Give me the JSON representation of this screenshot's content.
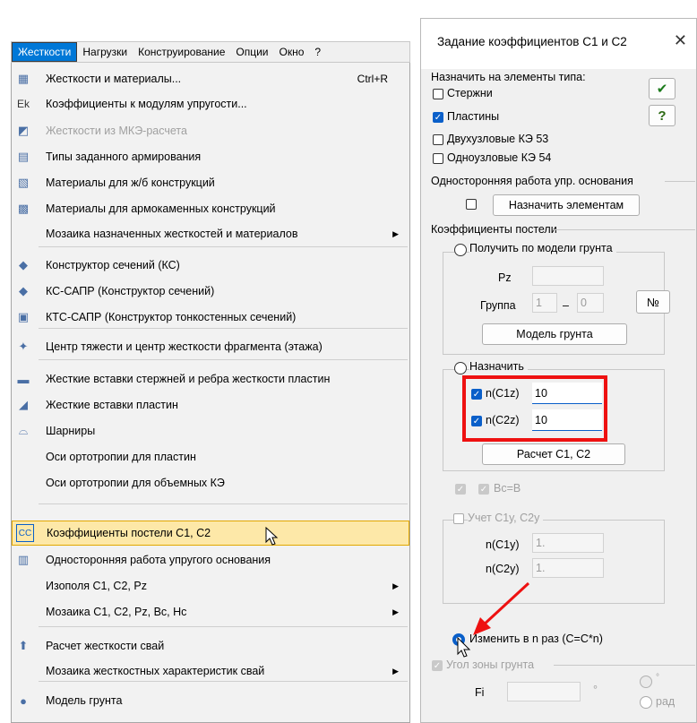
{
  "menubar": [
    "Жесткости",
    "Нагрузки",
    "Конструирование",
    "Опции",
    "Окно",
    "?"
  ],
  "menu": {
    "items": [
      {
        "label": "Жесткости и материалы...",
        "shortcut": "Ctrl+R",
        "icon": "stiffness-materials-icon"
      },
      {
        "label": "Коэффициенты к модулям упругости...",
        "icon": "ek-icon",
        "glyph": "Ek"
      },
      {
        "label": "Жесткости из МКЭ-расчета",
        "icon": "fem-stiffness-icon",
        "disabled": true
      },
      {
        "label": "Типы заданного армирования",
        "icon": "reinforcement-types-icon"
      },
      {
        "label": "Материалы для ж/б конструкций",
        "icon": "rc-materials-icon"
      },
      {
        "label": "Материалы для армокаменных конструкций",
        "icon": "masonry-materials-icon"
      },
      {
        "label": "Мозаика назначенных жесткостей и материалов",
        "submenu": true
      },
      {
        "label": "Конструктор сечений (КС)",
        "icon": "section-designer-icon"
      },
      {
        "label": "КС-САПР (Конструктор сечений)",
        "icon": "ks-sapr-icon"
      },
      {
        "label": "КТС-САПР (Конструктор тонкостенных сечений)",
        "icon": "kts-sapr-icon"
      },
      {
        "label": "Центр тяжести и центр жесткости фрагмента (этажа)",
        "icon": "center-gravity-icon"
      },
      {
        "label": "Жесткие вставки стержней и ребра жесткости пластин",
        "icon": "rigid-inserts-bars-icon"
      },
      {
        "label": "Жесткие вставки пластин",
        "icon": "rigid-inserts-plates-icon"
      },
      {
        "label": "Шарниры",
        "icon": "hinges-icon"
      },
      {
        "label": "Оси ортотропии для пластин"
      },
      {
        "label": "Оси ортотропии для объемных КЭ"
      },
      {
        "label": "Коэффициенты постели С1, С2",
        "icon": "subgrade-coefficients-icon",
        "glyph": "CC",
        "highlighted": true
      },
      {
        "label": "Односторонняя работа упругого основания",
        "icon": "one-sided-foundation-icon"
      },
      {
        "label": "Изополя С1, С2, Pz",
        "submenu": true
      },
      {
        "label": "Мозаика С1, С2, Pz, Bc, Hc",
        "submenu": true
      },
      {
        "label": "Расчет жесткости свай",
        "icon": "pile-stiffness-icon"
      },
      {
        "label": "Мозаика жесткостных характеристик свай",
        "submenu": true
      },
      {
        "label": "Модель грунта",
        "icon": "soil-model-icon"
      }
    ]
  },
  "dialog": {
    "title": "Задание коэффициентов С1 и С2",
    "close": "✕",
    "assign_label": "Назначить на элементы типа:",
    "element_types": [
      {
        "label": "Стержни",
        "checked": false
      },
      {
        "label": "Пластины",
        "checked": true
      },
      {
        "label": "Двухузловые КЭ 53",
        "checked": false
      },
      {
        "label": "Одноузловые КЭ 54",
        "checked": false
      }
    ],
    "ok_glyph": "✔",
    "help_glyph": "?",
    "one_sided_label": "Односторонняя работа упр. основания",
    "assign_elements_btn": "Назначить элементам",
    "bed_coeff_label": "Коэффициенты постели",
    "from_soil_label": "Получить по модели грунта",
    "pz_label": "Pz",
    "group_label": "Группа",
    "group_from": "1",
    "group_dash": "–",
    "group_to": "0",
    "number_btn": "№",
    "soil_model_btn": "Модель грунта",
    "assign_label2": "Назначить",
    "n_c1z_label": "n(C1z)",
    "n_c1z_value": "10",
    "n_c2z_label": "n(C2z)",
    "n_c2z_value": "10",
    "calc_btn": "Расчет С1, С2",
    "bc_label": "Bc=B",
    "c1y_group_label": "Учет С1у, С2у",
    "n_c1y_label": "n(C1y)",
    "n_c1y_value": "1.",
    "n_c2y_label": "n(C2y)",
    "n_c2y_value": "1.",
    "change_label": "Изменить в  n  раз (С=С*n)",
    "soil_angle_label": "Угол зоны грунта",
    "fi_label": "Fi",
    "degree_sign": "°",
    "rad_label": "рад",
    "colors": {
      "accent": "#0a5fc9",
      "highlight_box": "#e11111",
      "menu_highlight": "#fde8a8"
    }
  }
}
